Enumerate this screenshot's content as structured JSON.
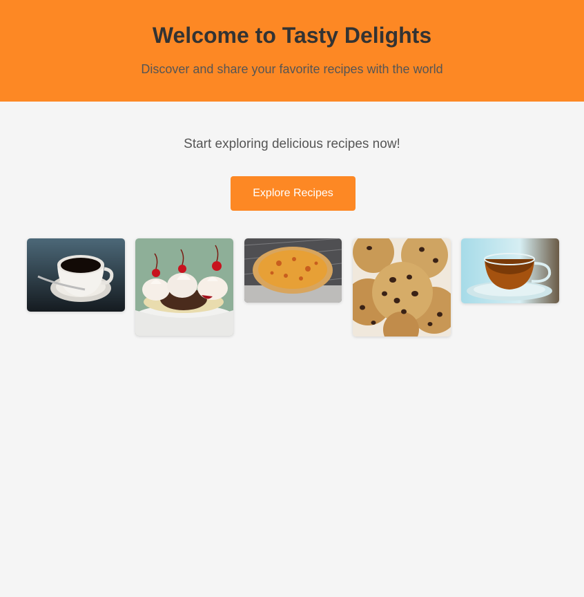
{
  "header": {
    "title": "Welcome to Tasty Delights",
    "subtitle": "Discover and share your favorite recipes with the world"
  },
  "main": {
    "tagline": "Start exploring delicious recipes now!",
    "explore_button_label": "Explore Recipes"
  },
  "gallery": {
    "images": [
      {
        "name": "coffee-cup-image",
        "depicts": "coffee"
      },
      {
        "name": "banana-split-image",
        "depicts": "banana split"
      },
      {
        "name": "pizza-image",
        "depicts": "pizza"
      },
      {
        "name": "cookies-image",
        "depicts": "chocolate chip cookies"
      },
      {
        "name": "tea-cup-image",
        "depicts": "tea"
      }
    ]
  },
  "colors": {
    "accent": "#fd8824",
    "background": "#f5f5f5",
    "heading": "#333333",
    "body_text": "#555555"
  }
}
